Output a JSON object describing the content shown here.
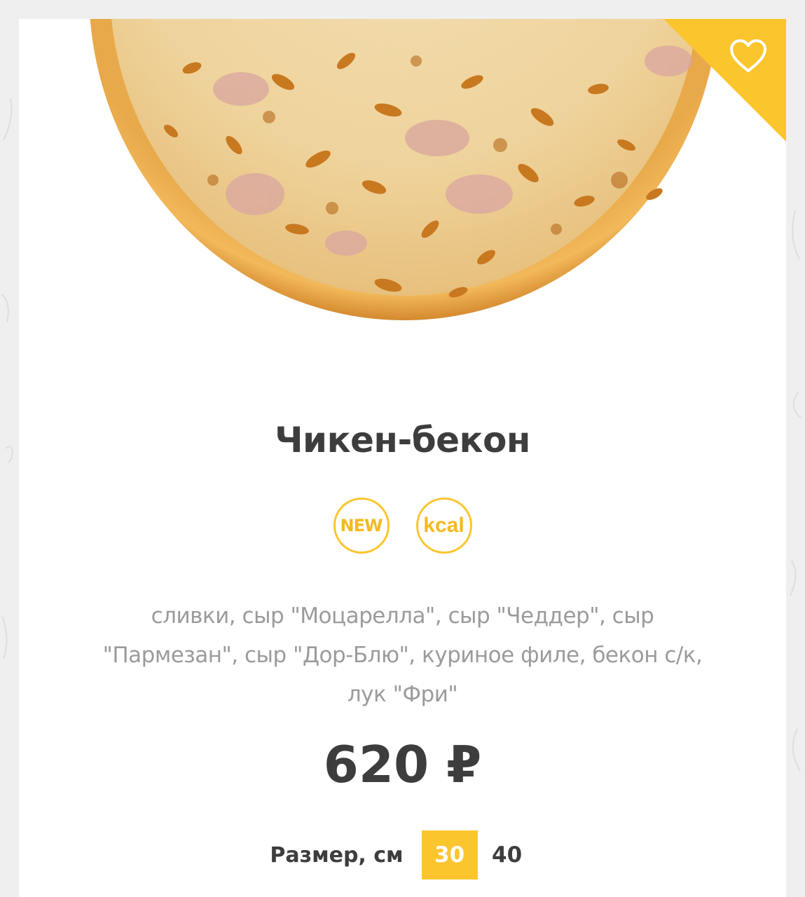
{
  "product": {
    "title": "Чикен-бекон",
    "badges": {
      "new": "NEW",
      "kcal": "kcal"
    },
    "ingredients": "сливки, сыр \"Моцарелла\", сыр \"Чеддер\", сыр \"Пармезан\", сыр \"Дор-Блю\", куриное филе, бекон с/к, лук \"Фри\"",
    "price": "620 ₽",
    "size": {
      "label": "Размер, см",
      "options": [
        "30",
        "40"
      ],
      "selected": "30"
    }
  },
  "icons": {
    "favorite": "heart-icon",
    "image": "pizza-image"
  },
  "colors": {
    "accent": "#fbc52d",
    "title": "#3d3d3d",
    "muted": "#9b9b9b"
  }
}
